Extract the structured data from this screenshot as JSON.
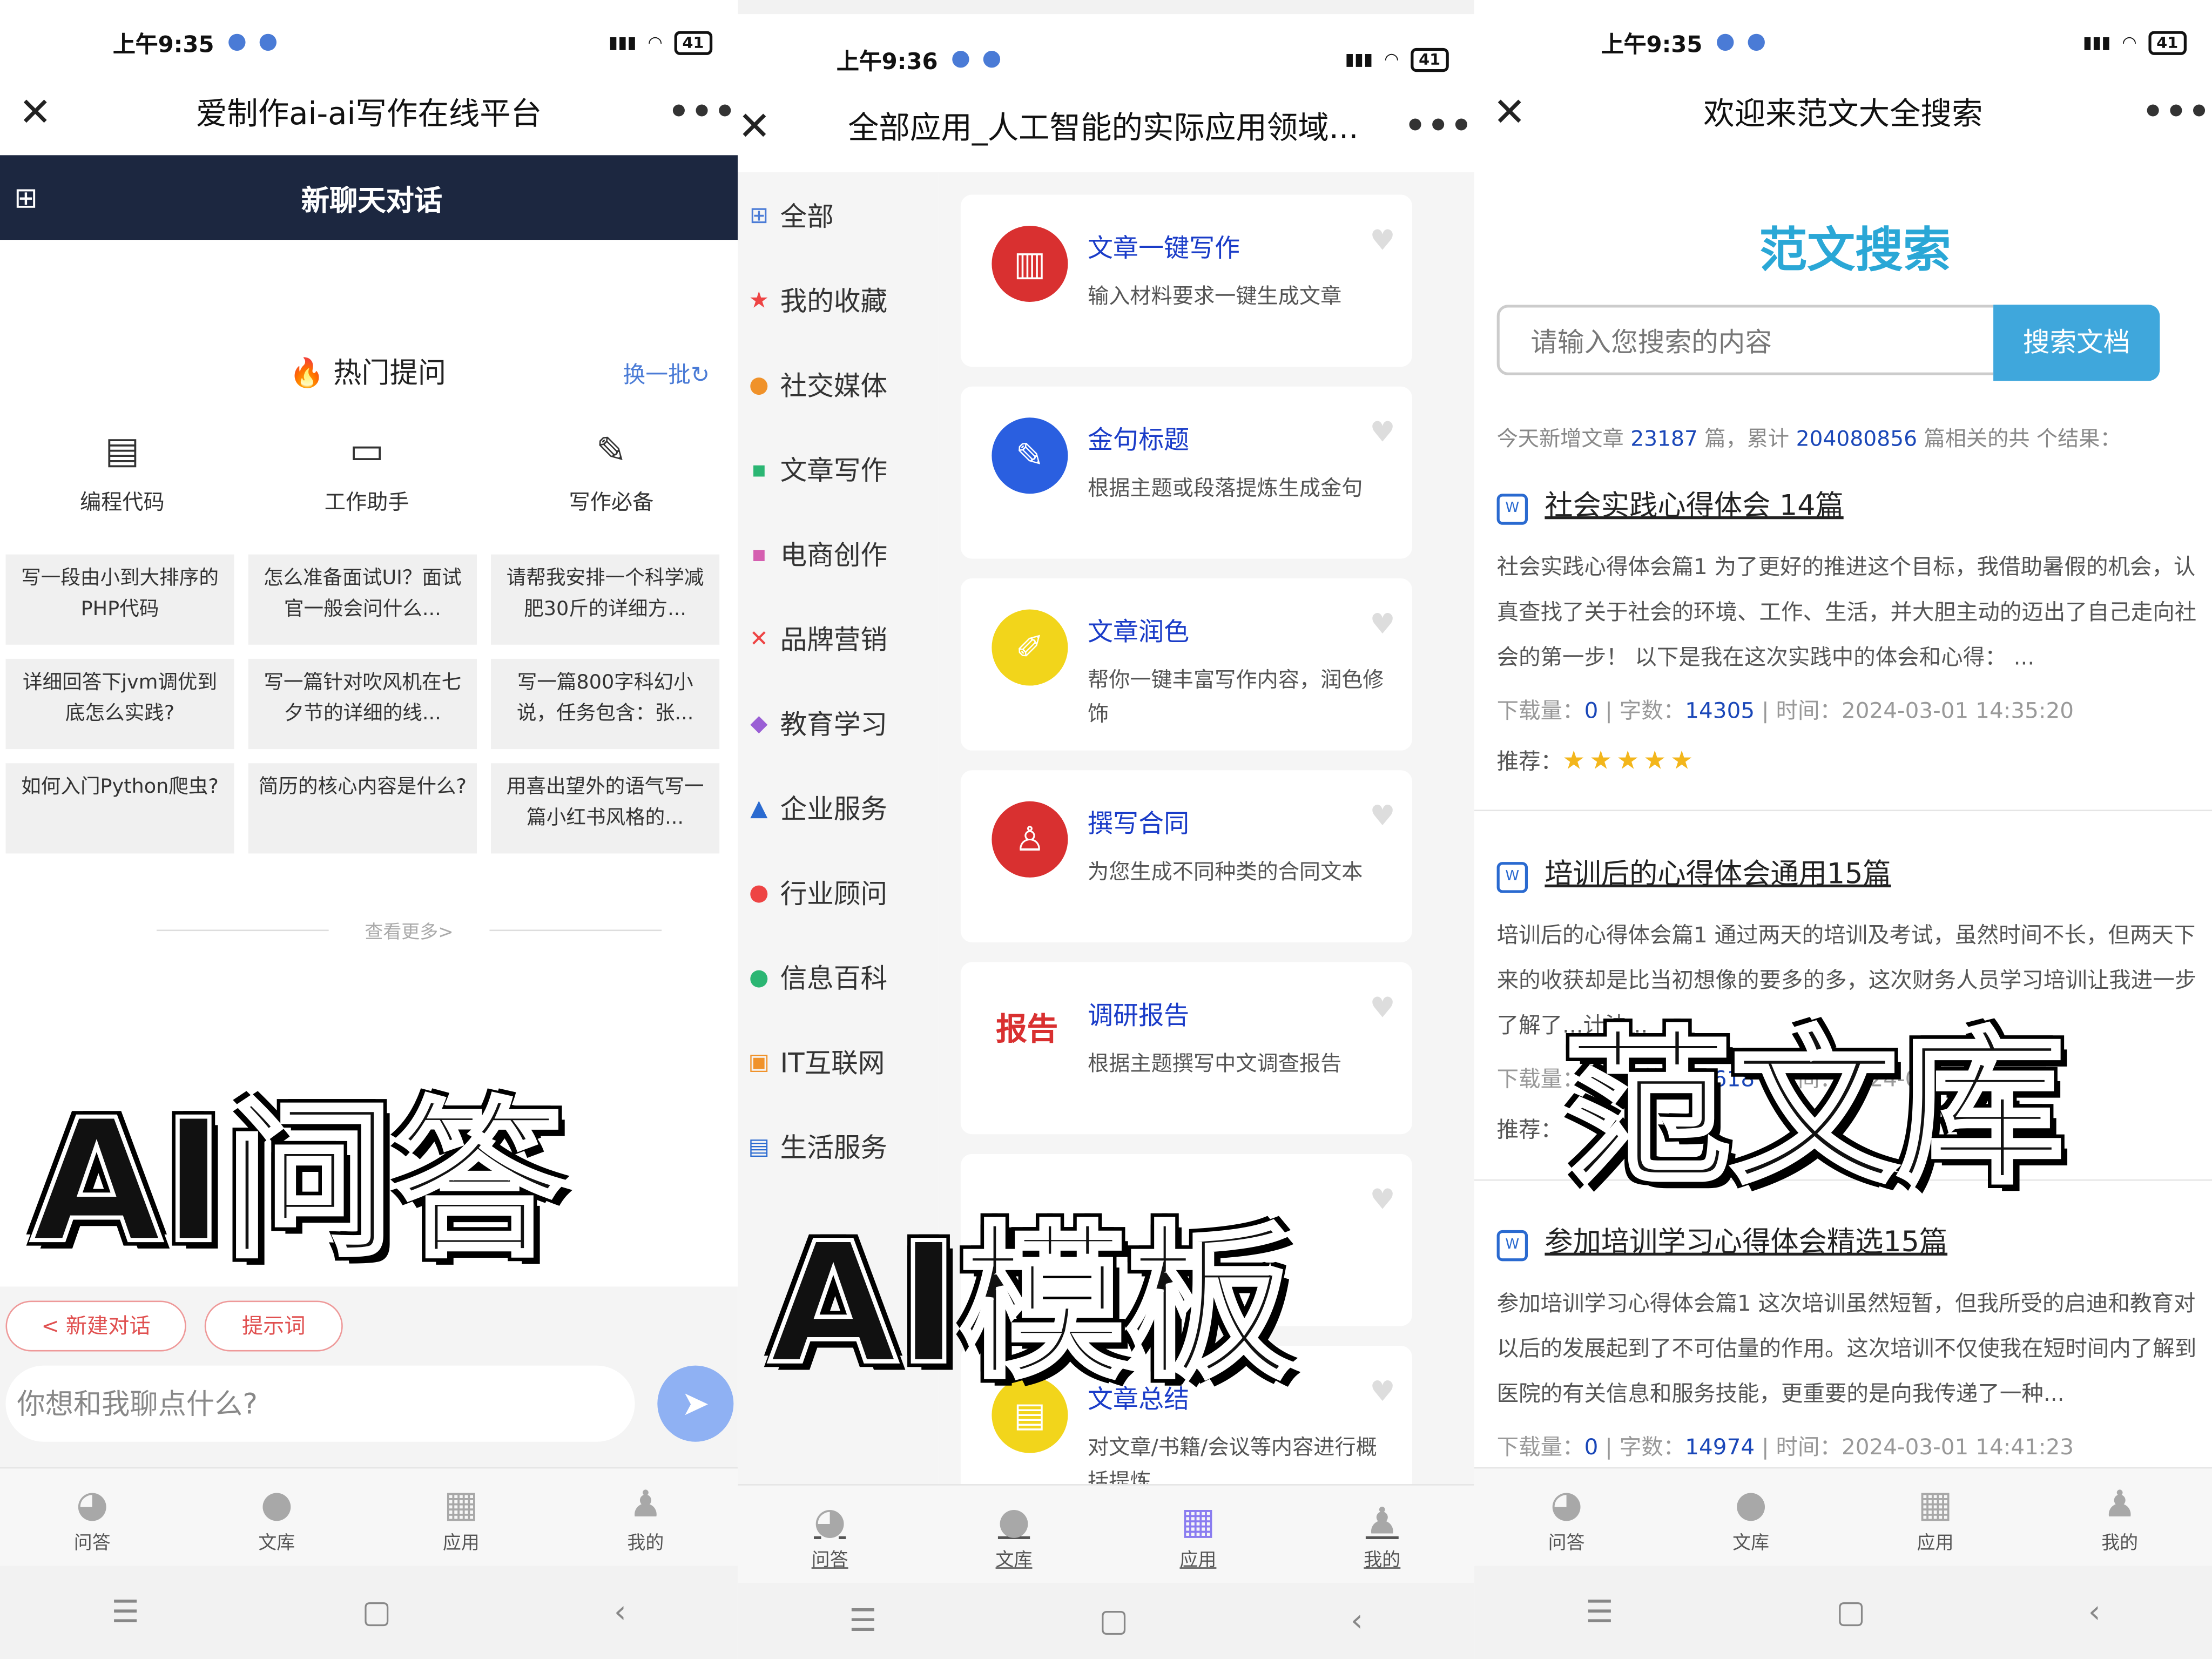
{
  "status": {
    "p1_time": "上午9:35",
    "p2_time": "上午9:36",
    "p3_time": "上午9:35",
    "battery": "41"
  },
  "panel1": {
    "title": "爱制作ai-ai写作在线平台",
    "chat_header": "新聊天对话",
    "hot_label": "热门提问",
    "refresh_label": "换一批",
    "categories": [
      "编程代码",
      "工作助手",
      "写作必备"
    ],
    "questions": [
      "写一段由小到大排序的PHP代码",
      "怎么准备面试UI？面试官一般会问什么...",
      "请帮我安排一个科学减肥30斤的详细方...",
      "详细回答下jvm调优到底怎么实践?",
      "写一篇针对吹风机在七夕节的详细的线...",
      "写一篇800字科幻小说，任务包含：张...",
      "如何入门Python爬虫?",
      "简历的核心内容是什么?",
      "用喜出望外的语气写一篇小红书风格的..."
    ],
    "see_more": "查看更多>",
    "overlay_text": "AI问答",
    "new_chat": "新建对话",
    "prompt_words": "提示词",
    "input_placeholder": "你想和我聊点什么?"
  },
  "panel2": {
    "title": "全部应用_人工智能的实际应用领域...",
    "sidebar": [
      "全部",
      "我的收藏",
      "社交媒体",
      "文章写作",
      "电商创作",
      "品牌营销",
      "教育学习",
      "企业服务",
      "行业顾问",
      "信息百科",
      "IT互联网",
      "生活服务"
    ],
    "cards": [
      {
        "title": "文章一键写作",
        "desc": "输入材料要求一键生成文章",
        "color": "#d93030"
      },
      {
        "title": "金句标题",
        "desc": "根据主题或段落提炼生成金句",
        "color": "#2a5fe0"
      },
      {
        "title": "文章润色",
        "desc": "帮你一键丰富写作内容，润色修饰",
        "color": "#f2d51b"
      },
      {
        "title": "撰写合同",
        "desc": "为您生成不同种类的合同文本",
        "color": "#d93030"
      },
      {
        "title": "调研报告",
        "desc": "根据主题撰写中文调查报告",
        "color": "#ffffff"
      },
      {
        "title": "",
        "desc": "",
        "color": "#ffffff"
      },
      {
        "title": "文章总结",
        "desc": "对文章/书籍/会议等内容进行概括提炼",
        "color": "#f2d51b"
      }
    ],
    "report_icon_text": "报告",
    "overlay_text": "AI模板"
  },
  "panel3": {
    "title": "欢迎来范文大全搜索",
    "logo": "范文搜索",
    "search_placeholder": "请输入您搜索的内容",
    "search_button": "搜索文档",
    "stats_prefix": "今天新增文章",
    "today_count": "23187",
    "stats_mid": "篇，累计",
    "total_count": "204080856",
    "stats_suffix": "篇相关的共 个结果：",
    "results": [
      {
        "title": "社会实践心得体会 14篇",
        "body": "社会实践心得体会篇1 为了更好的推进这个目标，我借助暑假的机会，认真查找了关于社会的环境、工作、生活，并大胆主动的迈出了自己走向社会的第一步！ 以下是我在这次实践中的体会和心得： ...",
        "downloads": "0",
        "words": "14305",
        "time": "2024-03-01 14:35:20"
      },
      {
        "title": "培训后的心得体会通用15篇",
        "body": "培训后的心得体会篇1 通过两天的培训及考试，虽然时间不长，但两天下来的收获却是比当初想像的要多的多，这次财务人员学习培训让我进一步了解了...计法...",
        "downloads": "0",
        "words": "15618",
        "time": "2024-03-01"
      },
      {
        "title": "参加培训学习心得体会精选15篇",
        "body": "参加培训学习心得体会篇1 这次培训虽然短暂，但我所受的启迪和教育对以后的发展起到了不可估量的作用。这次培训不仅使我在短时间内了解到医院的有关信息和服务技能，更重要的是向我传递了一种...",
        "downloads": "0",
        "words": "14974",
        "time": "2024-03-01 14:41:23"
      }
    ],
    "label_downloads": "下载量：",
    "label_words": "字数：",
    "label_time": "时间：",
    "label_recommend": "推荐：",
    "stars": "★★★★★",
    "overlay_text": "范文库"
  },
  "tabs": [
    "问答",
    "文库",
    "应用",
    "我的"
  ],
  "nav": {
    "menu": "☰",
    "home": "▢",
    "back": "‹"
  }
}
